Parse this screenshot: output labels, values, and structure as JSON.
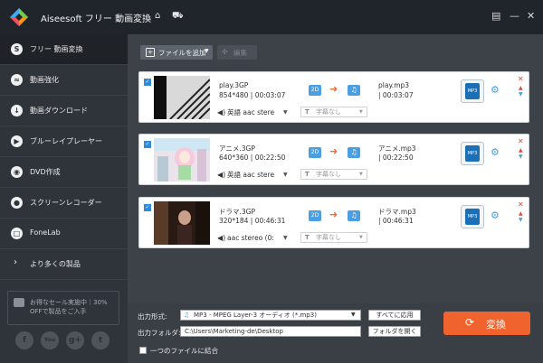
{
  "app": {
    "title": "Aiseesoft フリー 動画変換"
  },
  "icons": {
    "logo": "aiseesoft-logo-icon",
    "home": "home-icon",
    "cart": "cart-icon",
    "menu": "menu-icon",
    "minimize": "minimize-icon",
    "close": "close-icon"
  },
  "sidebar": {
    "items": [
      {
        "label": "フリー 動画変換",
        "icon": "S",
        "active": true
      },
      {
        "label": "動画強化",
        "icon": "≈",
        "active": false
      },
      {
        "label": "動画ダウンロード",
        "icon": "↓",
        "active": false
      },
      {
        "label": "ブルーレイプレーヤー",
        "icon": "▶",
        "active": false
      },
      {
        "label": "DVD作成",
        "icon": "◉",
        "active": false
      },
      {
        "label": "スクリーンレコーダー",
        "icon": "●",
        "active": false
      },
      {
        "label": "FoneLab",
        "icon": "□",
        "active": false
      },
      {
        "label": "より多くの製品",
        "icon": "›",
        "active": false
      }
    ],
    "promo": "お得なセール実施中｜30% OFFで製品をご入手",
    "social": [
      "f",
      "You",
      "g+",
      "t"
    ]
  },
  "toolbar": {
    "add_label": "ファイルを追加",
    "edit_label": "編集"
  },
  "files": [
    {
      "name": "play.3GP",
      "resolution": "854*480",
      "duration": "00:03:07",
      "output_name": "play.mp3",
      "output_duration": "| 00:03:07",
      "audio": "英語 aac stere",
      "subtitle": "字幕なし",
      "badge": "2D",
      "format_badge": "MP3"
    },
    {
      "name": "アニメ.3GP",
      "resolution": "640*360",
      "duration": "00:22:50",
      "output_name": "アニメ.mp3",
      "output_duration": "| 00:22:50",
      "audio": "英語 aac stere",
      "subtitle": "字幕なし",
      "badge": "2D",
      "format_badge": "MP3"
    },
    {
      "name": "ドラマ.3GP",
      "resolution": "320*184",
      "duration": "00:46:31",
      "output_name": "ドラマ.mp3",
      "output_duration": "| 00:46:31",
      "audio": "aac stereo (0:",
      "subtitle": "字幕なし",
      "badge": "2D",
      "format_badge": "MP3"
    }
  ],
  "bottom": {
    "format_label": "出力形式:",
    "format_value": "MP3 - MPEG Layer-3 オーディオ (*.mp3)",
    "apply_all": "すべてに応用",
    "folder_label": "出力フォルダ:",
    "folder_value": "C:\\Users\\Marketing-de\\Desktop",
    "folder_more": "···",
    "open_folder": "フォルダを開く",
    "merge_label": "一つのファイルに結合",
    "convert_label": "変換"
  },
  "colors": {
    "accent": "#f0632e",
    "blue": "#4a9ee2",
    "sidebar": "#2f343b",
    "main": "#3d4148"
  }
}
